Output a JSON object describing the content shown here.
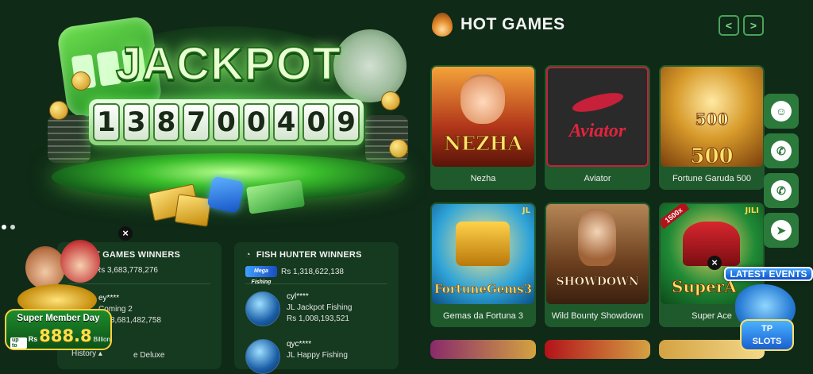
{
  "jackpot": {
    "title": "JACKPOT",
    "digits": [
      "1",
      "3",
      "8",
      "7",
      "0",
      "0",
      "4",
      "0",
      "9"
    ]
  },
  "hot_winners": {
    "title": "HOT GAMES WINNERS",
    "total": "Rs 3,683,778,276",
    "rows": [
      {
        "name": "ey****",
        "game": "Coming 2",
        "amount": "Rs 3,681,482,758"
      },
      {
        "name": "",
        "game": "e Deluxe",
        "amount": ""
      }
    ],
    "history_label": "History"
  },
  "fish_winners": {
    "title": "FISH HUNTER WINNERS",
    "logo_text": "Mega Fishing",
    "total": "Rs 1,318,622,138",
    "rows": [
      {
        "name": "cyl****",
        "game": "JL Jackpot Fishing",
        "amount": "Rs 1,008,193,521"
      },
      {
        "name": "qyc****",
        "game": "JL Happy Fishing",
        "amount": ""
      }
    ]
  },
  "promo": {
    "title": "Super Member Day",
    "upto": "up to",
    "currency": "Rs",
    "amount": "888.8",
    "unit": "Billion",
    "close": "×"
  },
  "hot_games": {
    "title": "HOT GAMES",
    "prev": "<",
    "next": ">",
    "games": [
      {
        "name": "Nezha",
        "thumb_text": "NEZHA",
        "provider": "",
        "multiplier": ""
      },
      {
        "name": "Aviator",
        "thumb_text": "Aviator",
        "provider": "",
        "multiplier": ""
      },
      {
        "name": "Fortune Garuda 500",
        "thumb_text": "500",
        "provider": "",
        "multiplier": ""
      },
      {
        "name": "Gemas da Fortuna 3",
        "thumb_text": "FortuneGems3",
        "provider": "JL",
        "multiplier": ""
      },
      {
        "name": "Wild Bounty Showdown",
        "thumb_text": "SHOWDOWN",
        "provider": "",
        "multiplier": ""
      },
      {
        "name": "Super Ace",
        "thumb_text": "SuperA",
        "provider": "JILI",
        "multiplier": "1500x"
      }
    ]
  },
  "events": {
    "title": "LATEST EVENTS",
    "brand_line1": "TP",
    "brand_line2": "SLOTS",
    "close": "×"
  },
  "float_buttons": [
    "support-icon",
    "whatsapp-icon",
    "whatsapp-icon",
    "telegram-icon"
  ],
  "colors": {
    "background": "#0f2a17",
    "panel": "#153a1f",
    "card": "#1f5a2c",
    "accent": "#4aa35a",
    "float": "#2b7a3b"
  }
}
